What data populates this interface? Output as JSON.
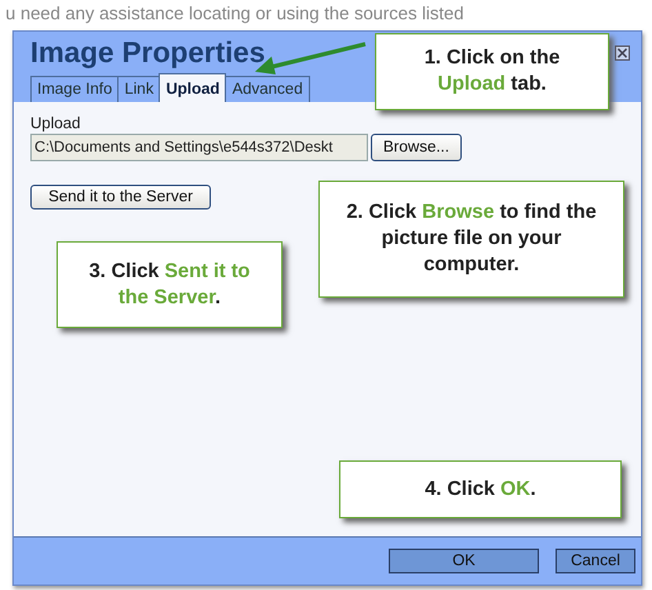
{
  "background_text": "u need any assistance locating or using the sources listed",
  "window": {
    "title": "Image Properties"
  },
  "tabs": [
    {
      "label": "Image Info",
      "selected": false
    },
    {
      "label": "Link",
      "selected": false
    },
    {
      "label": "Upload",
      "selected": true
    },
    {
      "label": "Advanced",
      "selected": false
    }
  ],
  "upload": {
    "label": "Upload",
    "value": "C:\\Documents and Settings\\e544s372\\Deskt",
    "browse_button": "Browse...",
    "send_button": "Send it to the Server"
  },
  "buttons": [
    {
      "label": "OK"
    },
    {
      "label": "Cancel"
    }
  ],
  "callouts": [
    {
      "before": "1. Click on the ",
      "highlight": "Upload",
      "after": " tab."
    },
    {
      "before": "2. Click ",
      "highlight": "Browse",
      "after": " to find the picture file on your computer."
    },
    {
      "before": "3. Click ",
      "highlight": "Sent it to the Server",
      "after": "."
    },
    {
      "before": "4. Click ",
      "highlight": "OK",
      "after": "."
    }
  ]
}
